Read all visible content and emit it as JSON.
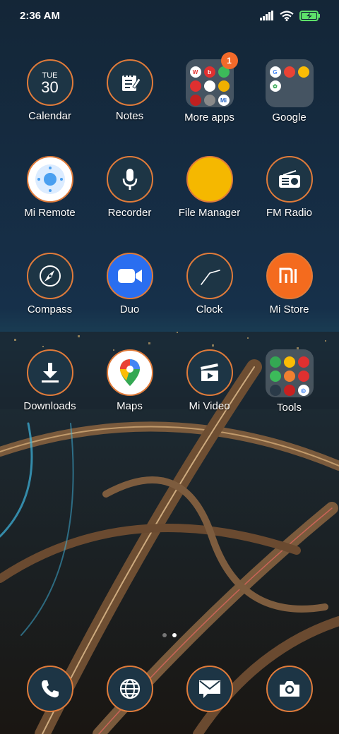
{
  "status_bar": {
    "time": "2:36 AM"
  },
  "calendar": {
    "weekday": "TUE",
    "day": "30"
  },
  "apps": [
    {
      "label": "Calendar"
    },
    {
      "label": "Notes"
    },
    {
      "label": "More apps",
      "badge": "1"
    },
    {
      "label": "Google"
    },
    {
      "label": "Mi Remote"
    },
    {
      "label": "Recorder"
    },
    {
      "label": "File Manager"
    },
    {
      "label": "FM Radio"
    },
    {
      "label": "Compass"
    },
    {
      "label": "Duo"
    },
    {
      "label": "Clock"
    },
    {
      "label": "Mi Store"
    },
    {
      "label": "Downloads"
    },
    {
      "label": "Maps"
    },
    {
      "label": "Mi Video"
    },
    {
      "label": "Tools"
    }
  ],
  "dock": [
    {
      "icon": "phone-icon"
    },
    {
      "icon": "browser-icon"
    },
    {
      "icon": "messages-icon"
    },
    {
      "icon": "camera-icon"
    }
  ],
  "colors": {
    "ring": "#e07b3a",
    "icon_bg": "#1d3545",
    "badge": "#f26a2a"
  }
}
